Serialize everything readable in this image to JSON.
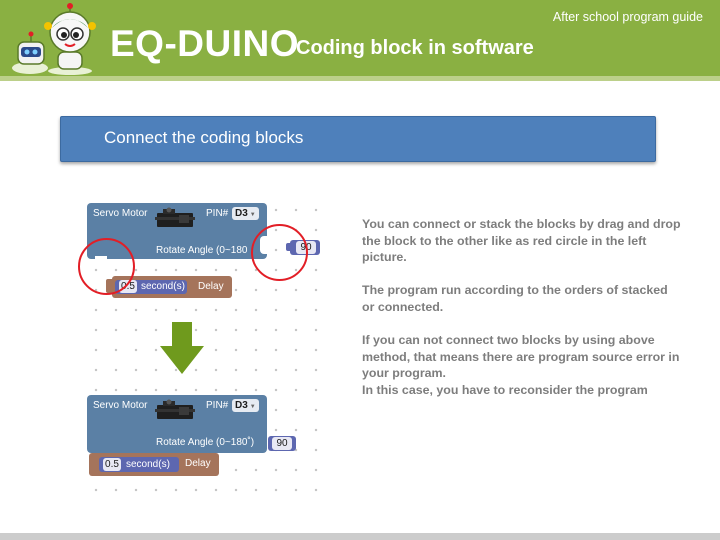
{
  "header": {
    "title": "EQ-DUINO",
    "subtitle": "Coding block in software",
    "guide": "After school program guide"
  },
  "section": {
    "title": "Connect the coding blocks"
  },
  "blocks_top": {
    "servo_label": "Servo Motor",
    "pin_label": "PIN#",
    "pin_value": "D3",
    "angle_label": "Rotate Angle (0~180",
    "angle_value": "90",
    "delay_value": "0.5",
    "delay_unit": "second(s)",
    "delay_label": "Delay"
  },
  "blocks_bottom": {
    "servo_label": "Servo Motor",
    "pin_label": "PIN#",
    "pin_value": "D3",
    "angle_label": "Rotate Angle (0~180˚)",
    "angle_value": "90",
    "delay_value": "0.5",
    "delay_unit": "second(s)",
    "delay_label": "Delay"
  },
  "description": {
    "p1": "You can connect or stack the blocks by drag and drop the block to the other like as red circle in the left picture.",
    "p2": "The program run according to the orders of stacked or connected.",
    "p3": "If you can not connect two blocks by using above method, that means there are program source error in your program.",
    "p4": "In this case, you have to reconsider the program"
  },
  "colors": {
    "header_green": "#8ab042",
    "section_blue": "#4e80bb",
    "servo_block": "#5b80a5",
    "delay_block": "#a5745b",
    "number_block": "#5d67b0",
    "highlight_red": "#e21e26",
    "arrow_green": "#6f9a1d"
  }
}
